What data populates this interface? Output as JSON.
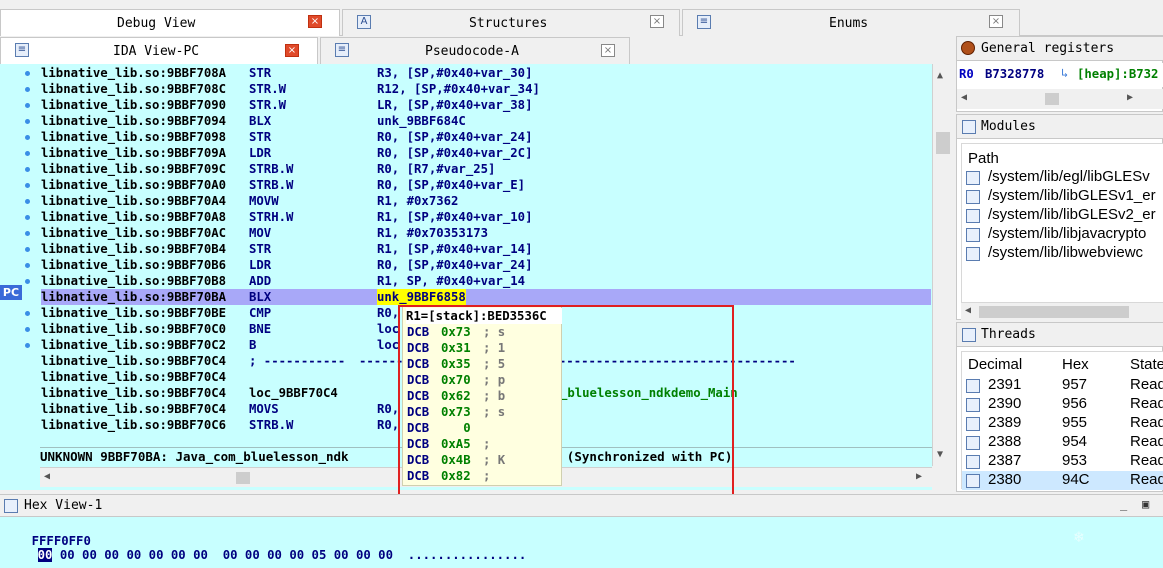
{
  "tabs_top": [
    {
      "label": "Debug View",
      "active": true
    },
    {
      "label": "Structures",
      "active": false
    },
    {
      "label": "Enums",
      "active": false
    }
  ],
  "tabs_second": [
    {
      "label": "IDA View-PC",
      "active": true
    },
    {
      "label": "Pseudocode-A",
      "active": false
    }
  ],
  "disasm": {
    "pc_label": "PC",
    "rows": [
      {
        "addr": "libnative_lib.so:9BBF708A",
        "mn": "STR",
        "op": "R3, [SP,#0x40+var_30]"
      },
      {
        "addr": "libnative_lib.so:9BBF708C",
        "mn": "STR.W",
        "op": "R12, [SP,#0x40+var_34]"
      },
      {
        "addr": "libnative_lib.so:9BBF7090",
        "mn": "STR.W",
        "op": "LR, [SP,#0x40+var_38]"
      },
      {
        "addr": "libnative_lib.so:9BBF7094",
        "mn": "BLX",
        "op": "unk_9BBF684C"
      },
      {
        "addr": "libnative_lib.so:9BBF7098",
        "mn": "STR",
        "op": "R0, [SP,#0x40+var_24]"
      },
      {
        "addr": "libnative_lib.so:9BBF709A",
        "mn": "LDR",
        "op": "R0, [SP,#0x40+var_2C]"
      },
      {
        "addr": "libnative_lib.so:9BBF709C",
        "mn": "STRB.W",
        "op": "R0, [R7,#var_25]"
      },
      {
        "addr": "libnative_lib.so:9BBF70A0",
        "mn": "STRB.W",
        "op": "R0, [SP,#0x40+var_E]"
      },
      {
        "addr": "libnative_lib.so:9BBF70A4",
        "mn": "MOVW",
        "op": "R1, #0x7362"
      },
      {
        "addr": "libnative_lib.so:9BBF70A8",
        "mn": "STRH.W",
        "op": "R1, [SP,#0x40+var_10]"
      },
      {
        "addr": "libnative_lib.so:9BBF70AC",
        "mn": "MOV",
        "op": "R1, #0x70353173"
      },
      {
        "addr": "libnative_lib.so:9BBF70B4",
        "mn": "STR",
        "op": "R1, [SP,#0x40+var_14]"
      },
      {
        "addr": "libnative_lib.so:9BBF70B6",
        "mn": "LDR",
        "op": "R0, [SP,#0x40+var_24]"
      },
      {
        "addr": "libnative_lib.so:9BBF70B8",
        "mn": "ADD",
        "op": "R1, SP, #0x40+var_14"
      },
      {
        "addr": "libnative_lib.so:9BBF70BA",
        "mn": "BLX",
        "op": "unk_9BBF6858"
      },
      {
        "addr": "libnative_lib.so:9BBF70BE",
        "mn": "CMP",
        "op": "R0,"
      },
      {
        "addr": "libnative_lib.so:9BBF70C0",
        "mn": "BNE",
        "op": "loc"
      },
      {
        "addr": "libnative_lib.so:9BBF70C2",
        "mn": "B",
        "op": "loc"
      },
      {
        "addr": "libnative_lib.so:9BBF70C4",
        "mn": "; -----------",
        "op": "-----------------------------------------------------------"
      },
      {
        "addr": "libnative_lib.so:9BBF70C4",
        "mn": "",
        "op": ""
      },
      {
        "addr": "libnative_lib.so:9BBF70C4",
        "mn": "loc_9BBF70C4",
        "op": "                     ; CODE XREF: Java_com_bluelesson_ndkdemo_Main"
      },
      {
        "addr": "libnative_lib.so:9BBF70C4",
        "mn": "MOVS",
        "op": "R0,"
      },
      {
        "addr": "libnative_lib.so:9BBF70C6",
        "mn": "STRB.W",
        "op": "R0,"
      }
    ],
    "status": "UNKNOWN 9BBF70BA: Java_com_bluelesson_ndk                   _check+56 (Synchronized with PC)"
  },
  "popup": {
    "header": "R1=[stack]:BED3536C",
    "rows": [
      {
        "op": "DCB",
        "val": "0x73",
        "cmt": "; s"
      },
      {
        "op": "DCB",
        "val": "0x31",
        "cmt": "; 1"
      },
      {
        "op": "DCB",
        "val": "0x35",
        "cmt": "; 5"
      },
      {
        "op": "DCB",
        "val": "0x70",
        "cmt": "; p"
      },
      {
        "op": "DCB",
        "val": "0x62",
        "cmt": "; b"
      },
      {
        "op": "DCB",
        "val": "0x73",
        "cmt": "; s"
      },
      {
        "op": "DCB",
        "val": "   0",
        "cmt": ""
      },
      {
        "op": "DCB",
        "val": "0xA5",
        "cmt": ";"
      },
      {
        "op": "DCB",
        "val": "0x4B",
        "cmt": "; K"
      },
      {
        "op": "DCB",
        "val": "0x82",
        "cmt": ";"
      }
    ]
  },
  "registers": {
    "title": "General registers",
    "reg": "R0",
    "value": "B7328778",
    "link": "[heap]:B732"
  },
  "modules": {
    "title": "Modules",
    "column": "Path",
    "items": [
      "/system/lib/egl/libGLESv",
      "/system/lib/libGLESv1_er",
      "/system/lib/libGLESv2_er",
      "/system/lib/libjavacrypto",
      "/system/lib/libwebviewc"
    ]
  },
  "threads": {
    "title": "Threads",
    "columns": [
      "Decimal",
      "Hex",
      "State"
    ],
    "rows": [
      {
        "dec": "2391",
        "hex": "957",
        "state": "Read"
      },
      {
        "dec": "2390",
        "hex": "956",
        "state": "Read"
      },
      {
        "dec": "2389",
        "hex": "955",
        "state": "Read"
      },
      {
        "dec": "2388",
        "hex": "954",
        "state": "Read"
      },
      {
        "dec": "2387",
        "hex": "953",
        "state": "Read"
      },
      {
        "dec": "2380",
        "hex": "94C",
        "state": "Read"
      }
    ]
  },
  "hexview": {
    "title": "Hex View-1",
    "addr": "FFFF0FF0",
    "first_byte": "00",
    "bytes": " 00 00 00 00 00 00 00  00 00 00 00 05 00 00 00  ................"
  }
}
